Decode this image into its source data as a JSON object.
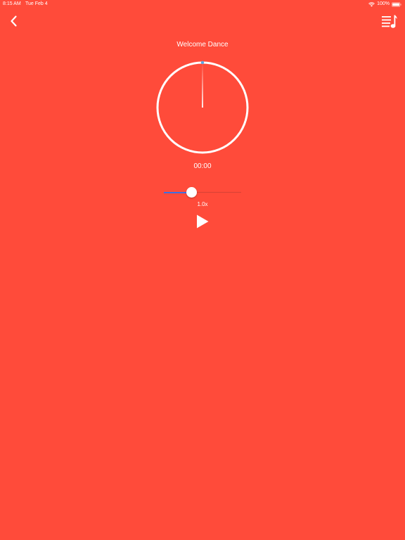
{
  "status_bar": {
    "time": "8:15 AM",
    "date": "Tue Feb 4",
    "battery": "100%"
  },
  "nav": {
    "back_icon": "chevron-left-icon",
    "playlist_icon": "playlist-music-icon"
  },
  "player": {
    "title": "Welcome Dance",
    "elapsed": "00:00",
    "progress": 0,
    "speed_label": "1.0x",
    "speed_position": 0.36,
    "play_icon": "play-icon"
  },
  "colors": {
    "background": "#ff4b3a",
    "foreground": "#ffffff",
    "accent": "#3d6fe0"
  }
}
